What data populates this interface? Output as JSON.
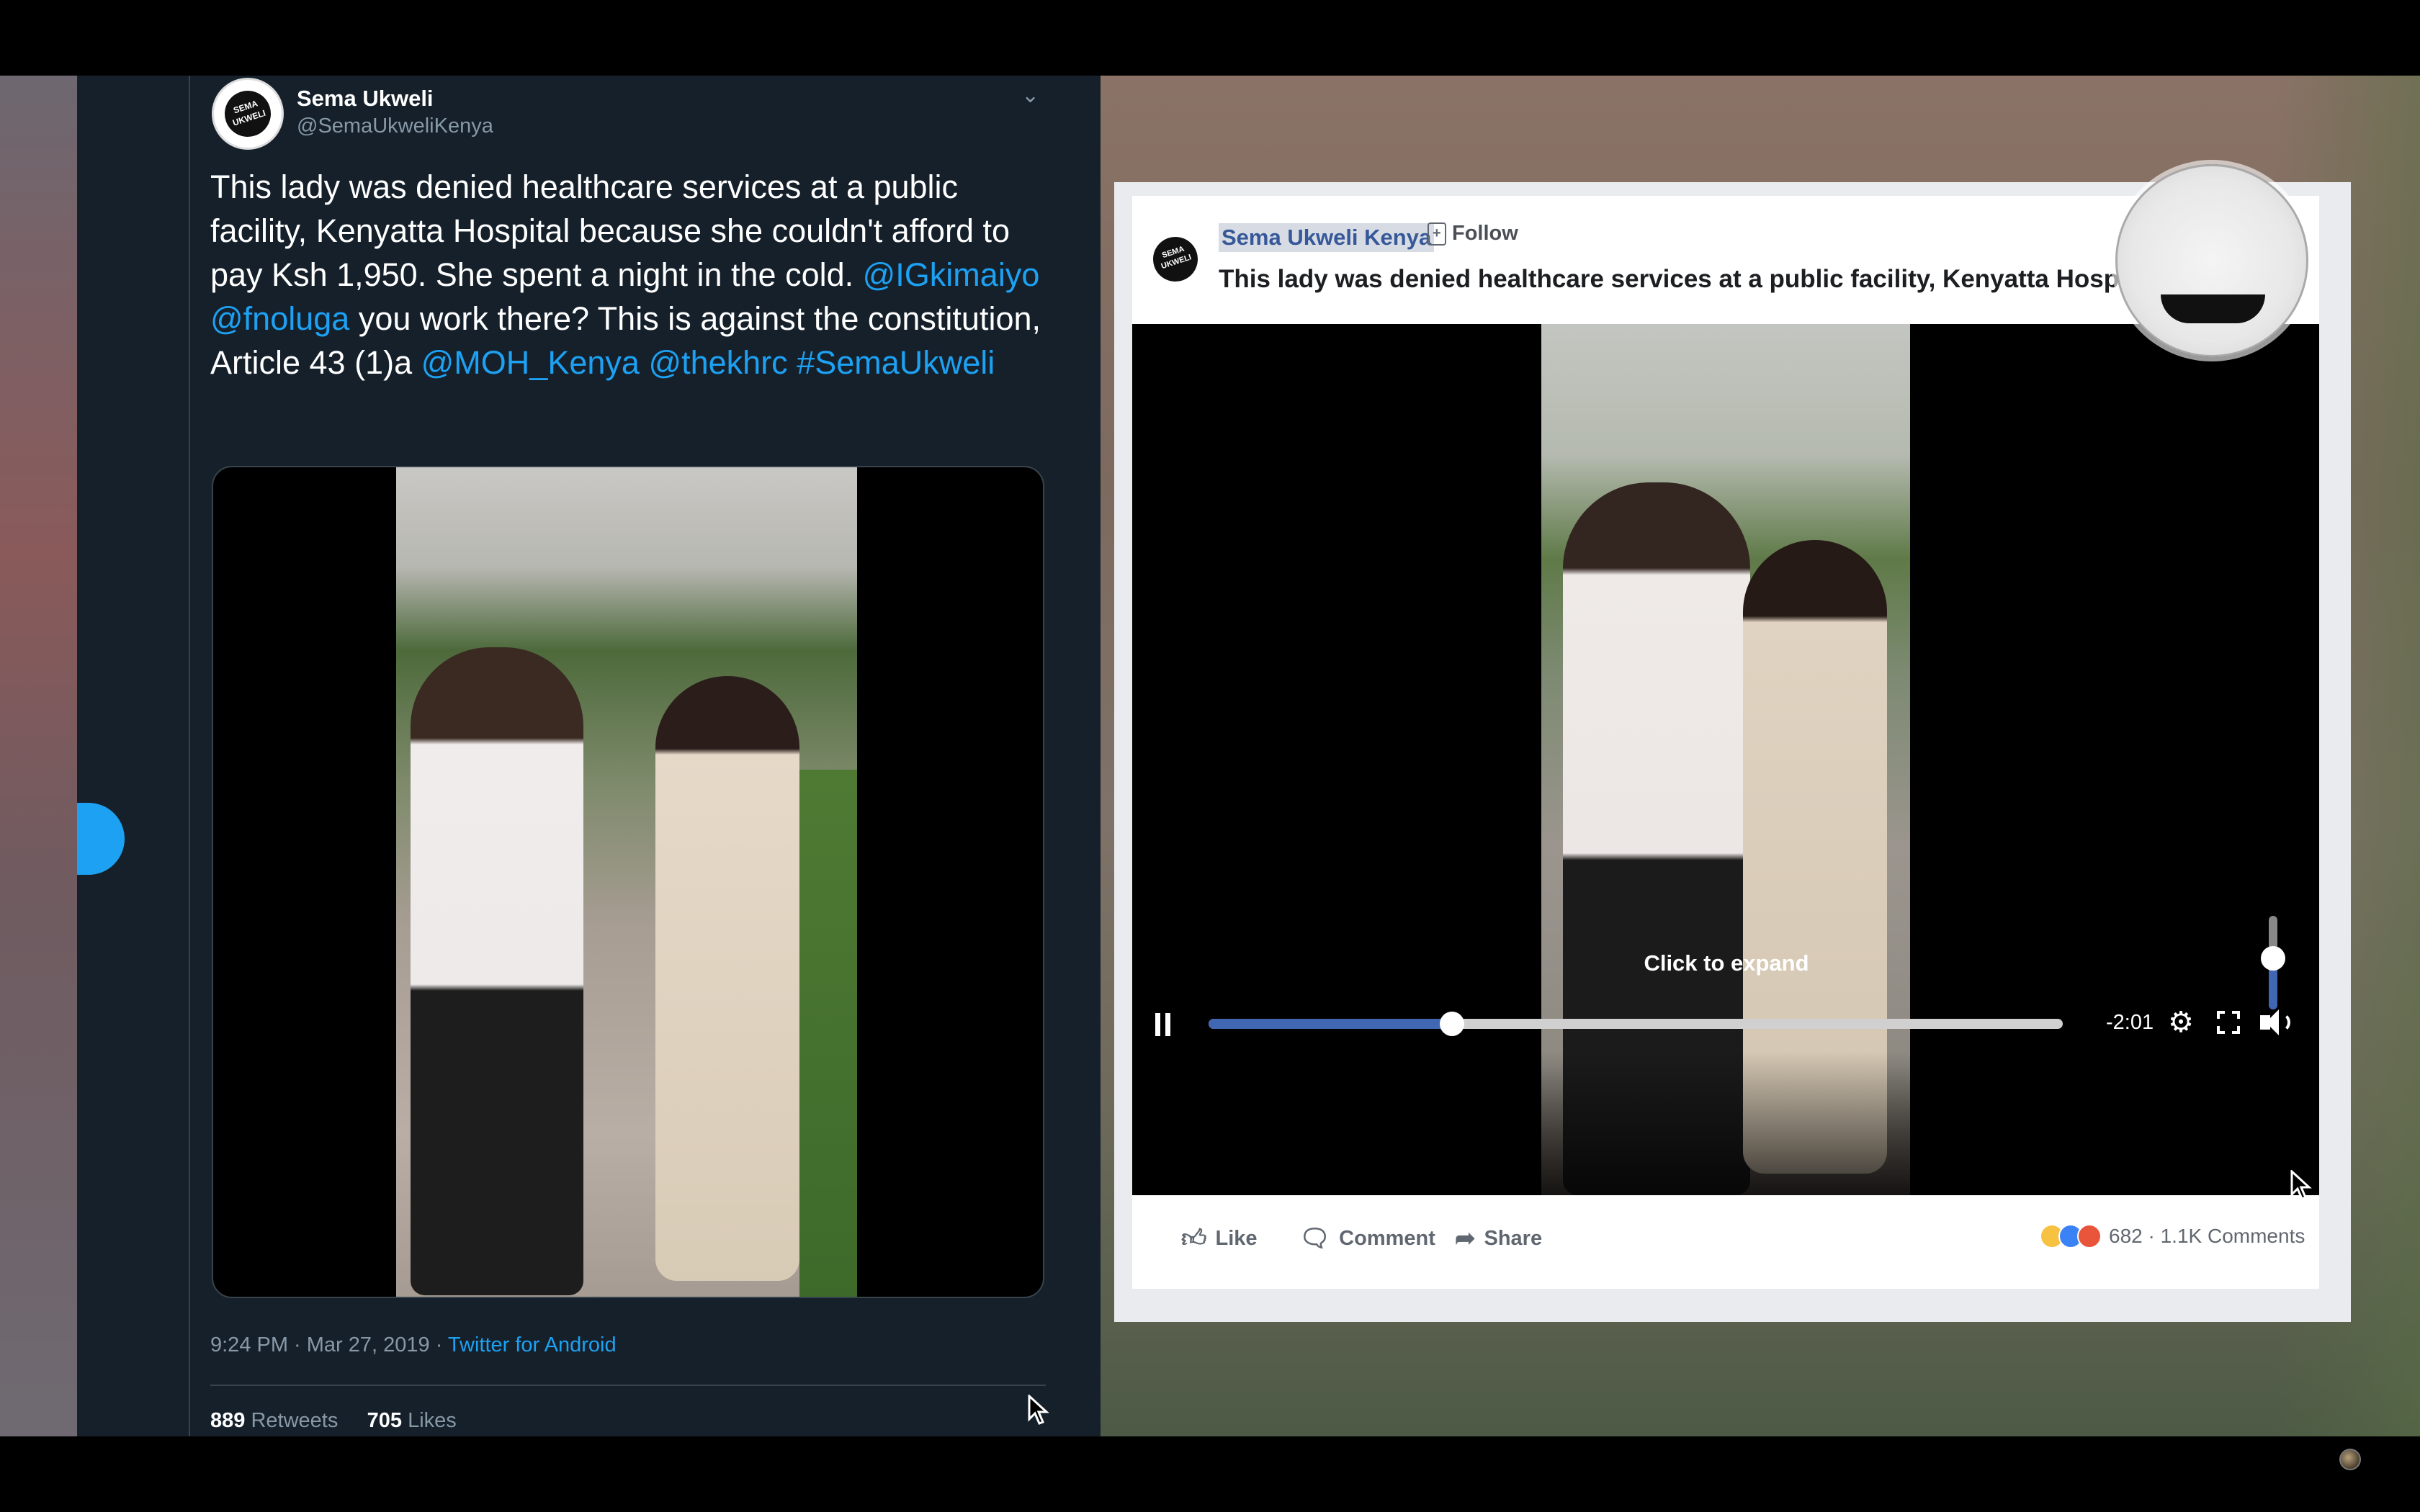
{
  "twitter": {
    "author_name": "Sema Ukweli",
    "author_handle": "@SemaUkweliKenya",
    "avatar_text": "SEMA UKWELI",
    "tweet_parts": [
      {
        "text": "This lady was denied healthcare services at a public facility, Kenyatta Hospital because she couldn't afford to pay Ksh 1,950. She spent a night in the cold. ",
        "link": false
      },
      {
        "text": "@IGkimaiyo",
        "link": true
      },
      {
        "text": " ",
        "link": false
      },
      {
        "text": "@fnoluga",
        "link": true
      },
      {
        "text": " you work there? This is against the constitution, Article 43 (1)a ",
        "link": false
      },
      {
        "text": "@MOH_Kenya",
        "link": true
      },
      {
        "text": " ",
        "link": false
      },
      {
        "text": "@thekhrc",
        "link": true
      },
      {
        "text": " ",
        "link": false
      },
      {
        "text": "#SemaUkweli",
        "link": true
      }
    ],
    "timestamp": "9:24 PM · Mar 27, 2019 · ",
    "source": "Twitter for Android",
    "retweets_count": "889",
    "retweets_label": " Retweets",
    "likes_count": "705",
    "likes_label": " Likes"
  },
  "facebook": {
    "page_name": "Sema Ukweli Kenya",
    "separator": "·",
    "follow_label": "Follow",
    "post_title": "This lady was denied healthcare services at a public facility, Kenyatta Hospital because...",
    "more_label": "···",
    "video": {
      "expand_label": "Click to expand",
      "time_remaining": "-2:01",
      "progress_fraction": 0.285,
      "volume_fraction": 0.55
    },
    "actions": {
      "like": "Like",
      "comment": "Comment",
      "share": "Share"
    },
    "reactions_summary": "682 · 1.1K Comments"
  },
  "colors": {
    "twitter_bg": "#15202b",
    "twitter_link": "#1da1f2",
    "facebook_blue": "#4267b2",
    "facebook_link": "#365899"
  }
}
